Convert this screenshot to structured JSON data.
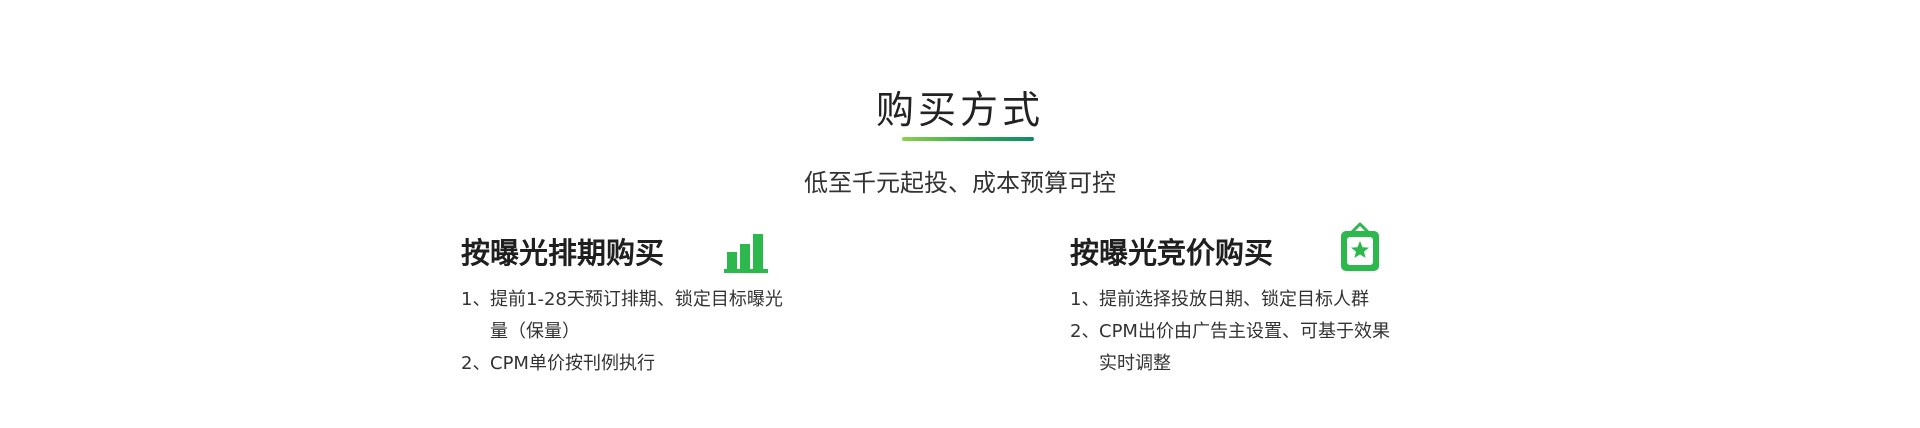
{
  "section": {
    "title": "购买方式",
    "subtitle": "低至千元起投、成本预算可控"
  },
  "cards": [
    {
      "title": "按曝光排期购买",
      "icon": "bar-chart-icon",
      "items": [
        {
          "num": "1、",
          "text": "提前1-28天预订排期、锁定目标曝光量（保量）"
        },
        {
          "num": "2、",
          "text": "CPM单价按刊例执行"
        }
      ]
    },
    {
      "title": "按曝光竞价购买",
      "icon": "star-badge-icon",
      "items": [
        {
          "num": "1、",
          "text": "提前选择投放日期、锁定目标人群"
        },
        {
          "num": "2、",
          "text": "CPM出价由广告主设置、可基于效果实时调整"
        }
      ]
    }
  ],
  "colors": {
    "accent": "#2db84d",
    "underline_start": "#8dd14a",
    "underline_end": "#0e8a6a"
  }
}
